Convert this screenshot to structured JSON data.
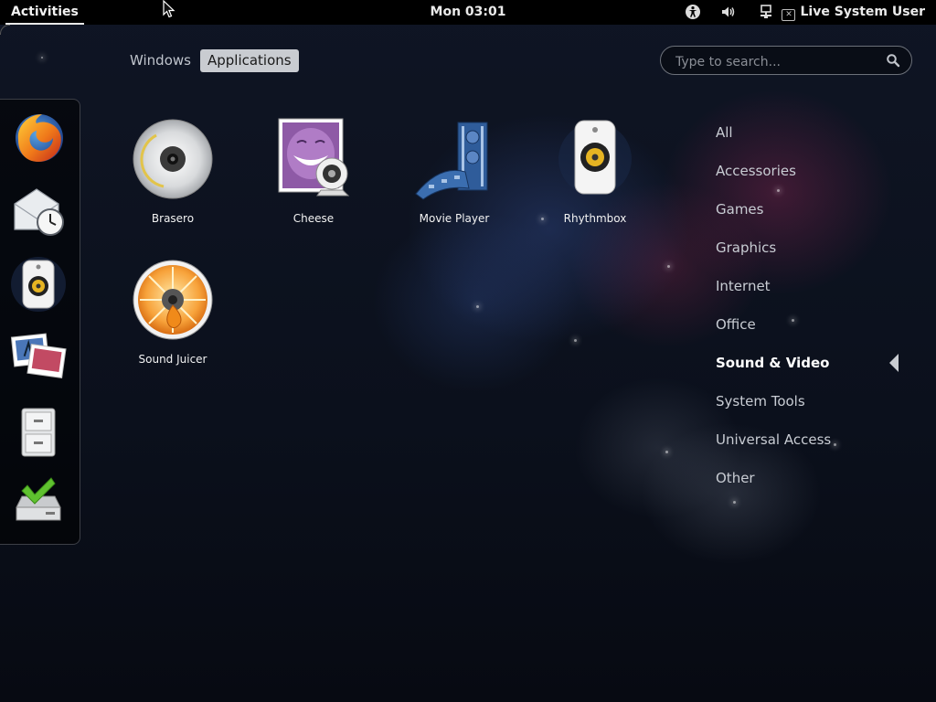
{
  "topbar": {
    "activities_label": "Activities",
    "clock": "Mon 03:01",
    "user_name": "Live System User",
    "tray_icons": [
      "accessibility-icon",
      "volume-icon",
      "network-icon"
    ]
  },
  "view_selector": {
    "windows_label": "Windows",
    "applications_label": "Applications",
    "active": "Applications"
  },
  "search": {
    "placeholder": "Type to search..."
  },
  "dash": {
    "items": [
      {
        "name": "firefox",
        "icon": "firefox-icon"
      },
      {
        "name": "evolution",
        "icon": "mail-clock-icon"
      },
      {
        "name": "rhythmbox",
        "icon": "speaker-icon"
      },
      {
        "name": "shotwell",
        "icon": "photos-icon"
      },
      {
        "name": "files",
        "icon": "file-cabinet-icon"
      },
      {
        "name": "install",
        "icon": "install-drive-icon"
      }
    ]
  },
  "apps": [
    {
      "label": "Brasero",
      "icon": "disc-icon"
    },
    {
      "label": "Cheese",
      "icon": "webcam-photo-icon"
    },
    {
      "label": "Movie Player",
      "icon": "film-reel-icon"
    },
    {
      "label": "Rhythmbox",
      "icon": "speaker-icon"
    },
    {
      "label": "Sound Juicer",
      "icon": "orange-disc-icon"
    }
  ],
  "categories": {
    "items": [
      "All",
      "Accessories",
      "Games",
      "Graphics",
      "Internet",
      "Office",
      "Sound & Video",
      "System Tools",
      "Universal Access",
      "Other"
    ],
    "selected": "Sound & Video"
  }
}
